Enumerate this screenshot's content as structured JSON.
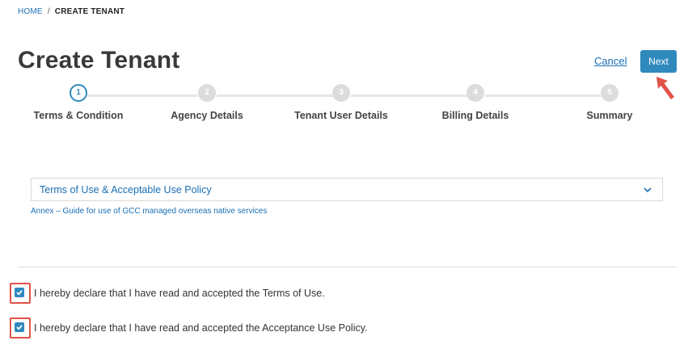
{
  "breadcrumb": {
    "home": "HOME",
    "separator": "/",
    "current": "CREATE TENANT"
  },
  "page": {
    "title": "Create Tenant"
  },
  "actions": {
    "cancel": "Cancel",
    "next": "Next"
  },
  "steps": [
    {
      "number": "1",
      "label": "Terms & Condition",
      "active": true
    },
    {
      "number": "2",
      "label": "Agency Details",
      "active": false
    },
    {
      "number": "3",
      "label": "Tenant User Details",
      "active": false
    },
    {
      "number": "4",
      "label": "Billing Details",
      "active": false
    },
    {
      "number": "5",
      "label": "Summary",
      "active": false
    }
  ],
  "terms": {
    "accordion_label": "Terms of Use & Acceptable Use Policy",
    "annex_link": "Annex – Guide for use of GCC managed overseas native services"
  },
  "declarations": [
    {
      "text": "I hereby declare that I have read and accepted the Terms of Use.",
      "checked": true
    },
    {
      "text": "I hereby declare that I have read and accepted the Acceptance Use Policy.",
      "checked": true
    }
  ],
  "colors": {
    "accent": "#2f89bd",
    "link": "#1a6fb5",
    "highlight": "#e0524a"
  }
}
